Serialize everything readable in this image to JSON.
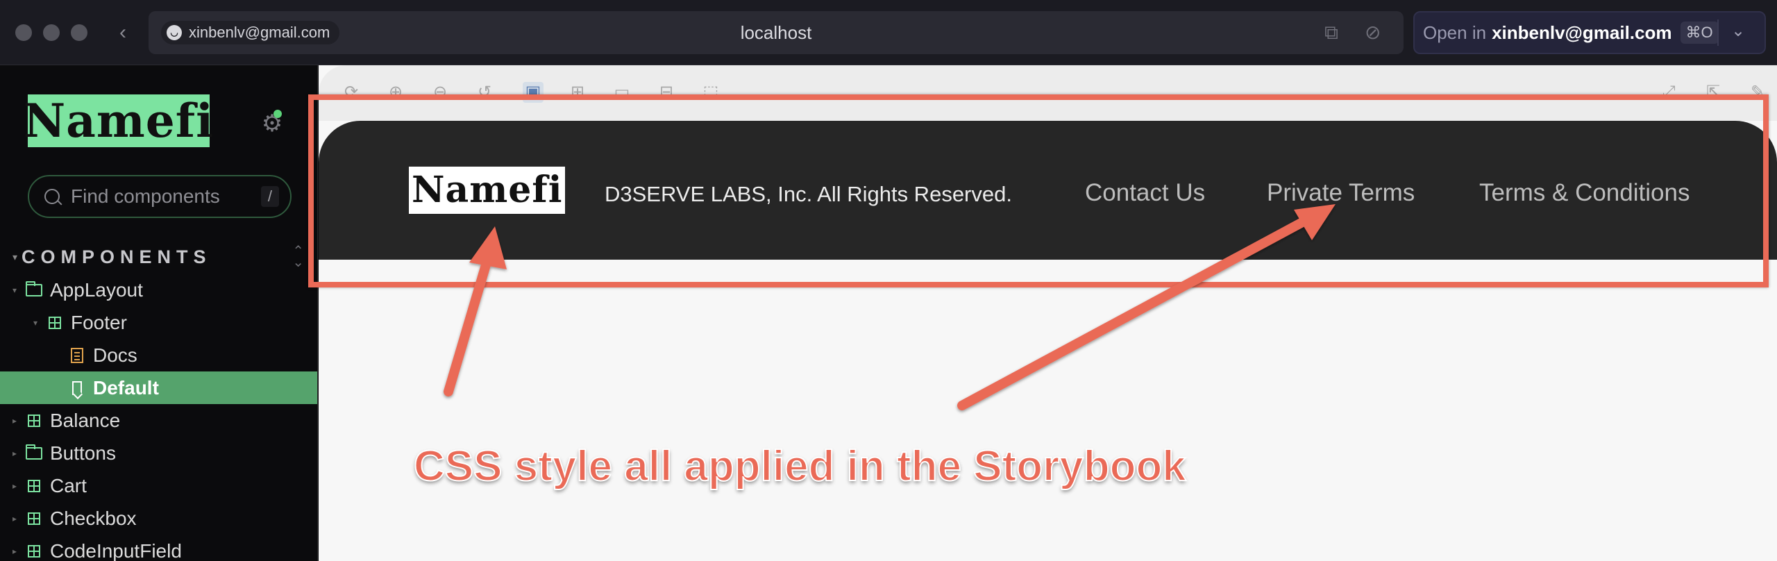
{
  "browser": {
    "account": "xinbenlv@gmail.com",
    "url_host": "localhost",
    "open_in_prefix": "Open in",
    "open_in_account": "xinbenlv@gmail.com",
    "shortcut": "⌘O",
    "back_glyph": "‹",
    "dropdown_glyph": "⌄",
    "account_icon": "◡"
  },
  "sidebar": {
    "logo": "Namefi",
    "gear_glyph": "⚙",
    "search_placeholder": "Find components",
    "search_shortcut": "/",
    "section_label": "COMPONENTS",
    "section_toggle": "⌃⌄",
    "tree": [
      {
        "label": "AppLayout",
        "type": "folder",
        "expanded": true
      },
      {
        "label": "Footer",
        "type": "component",
        "expanded": true
      },
      {
        "label": "Docs",
        "type": "docs"
      },
      {
        "label": "Default",
        "type": "story",
        "selected": true
      },
      {
        "label": "Balance",
        "type": "component"
      },
      {
        "label": "Buttons",
        "type": "folder"
      },
      {
        "label": "Cart",
        "type": "component"
      },
      {
        "label": "Checkbox",
        "type": "component"
      },
      {
        "label": "CodeInputField",
        "type": "component"
      }
    ]
  },
  "preview": {
    "footer_logo": "Namefi",
    "copyright": "D3SERVE LABS, Inc. All Rights Reserved.",
    "links": [
      "Contact Us",
      "Private Terms",
      "Terms & Conditions"
    ]
  },
  "annotation": {
    "text": "CSS style all applied in the Storybook",
    "color": "#ea6a57"
  },
  "colors": {
    "brand_green": "#7ce3a0",
    "selected_row": "#55a36c",
    "footer_bg": "#262626"
  }
}
